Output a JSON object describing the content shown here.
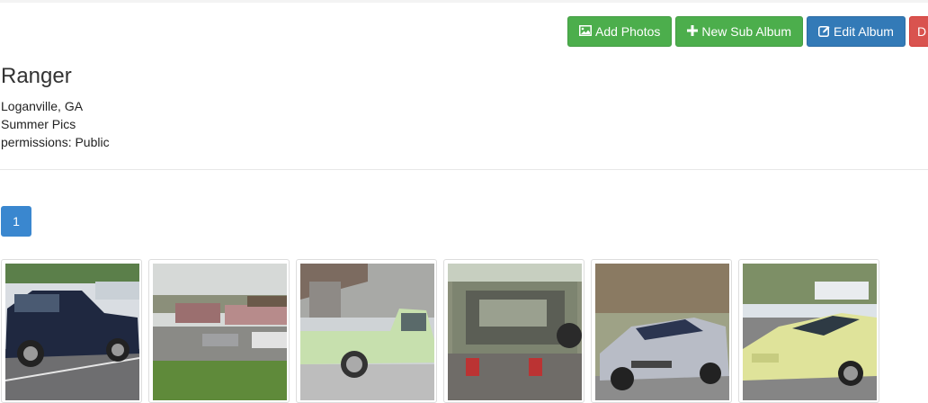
{
  "toolbar": {
    "add_photos": "Add Photos",
    "new_sub_album": "New Sub Album",
    "edit_album": "Edit Album",
    "delete_partial": "D"
  },
  "album": {
    "title": "Ranger",
    "location": "Loganville, GA",
    "description": "Summer Pics",
    "permissions": "permissions: Public"
  },
  "pagination": {
    "current_page": "1"
  },
  "photos": [
    {
      "subject": "dark blue pickup truck"
    },
    {
      "subject": "parking lot with trucks"
    },
    {
      "subject": "pale green pickup truck"
    },
    {
      "subject": "engine bay"
    },
    {
      "subject": "silver sports car"
    },
    {
      "subject": "yellow sports car"
    }
  ],
  "colors": {
    "success": "#4cae4c",
    "primary": "#337ab7",
    "danger": "#d9534f",
    "page_active": "#3a87cf"
  }
}
